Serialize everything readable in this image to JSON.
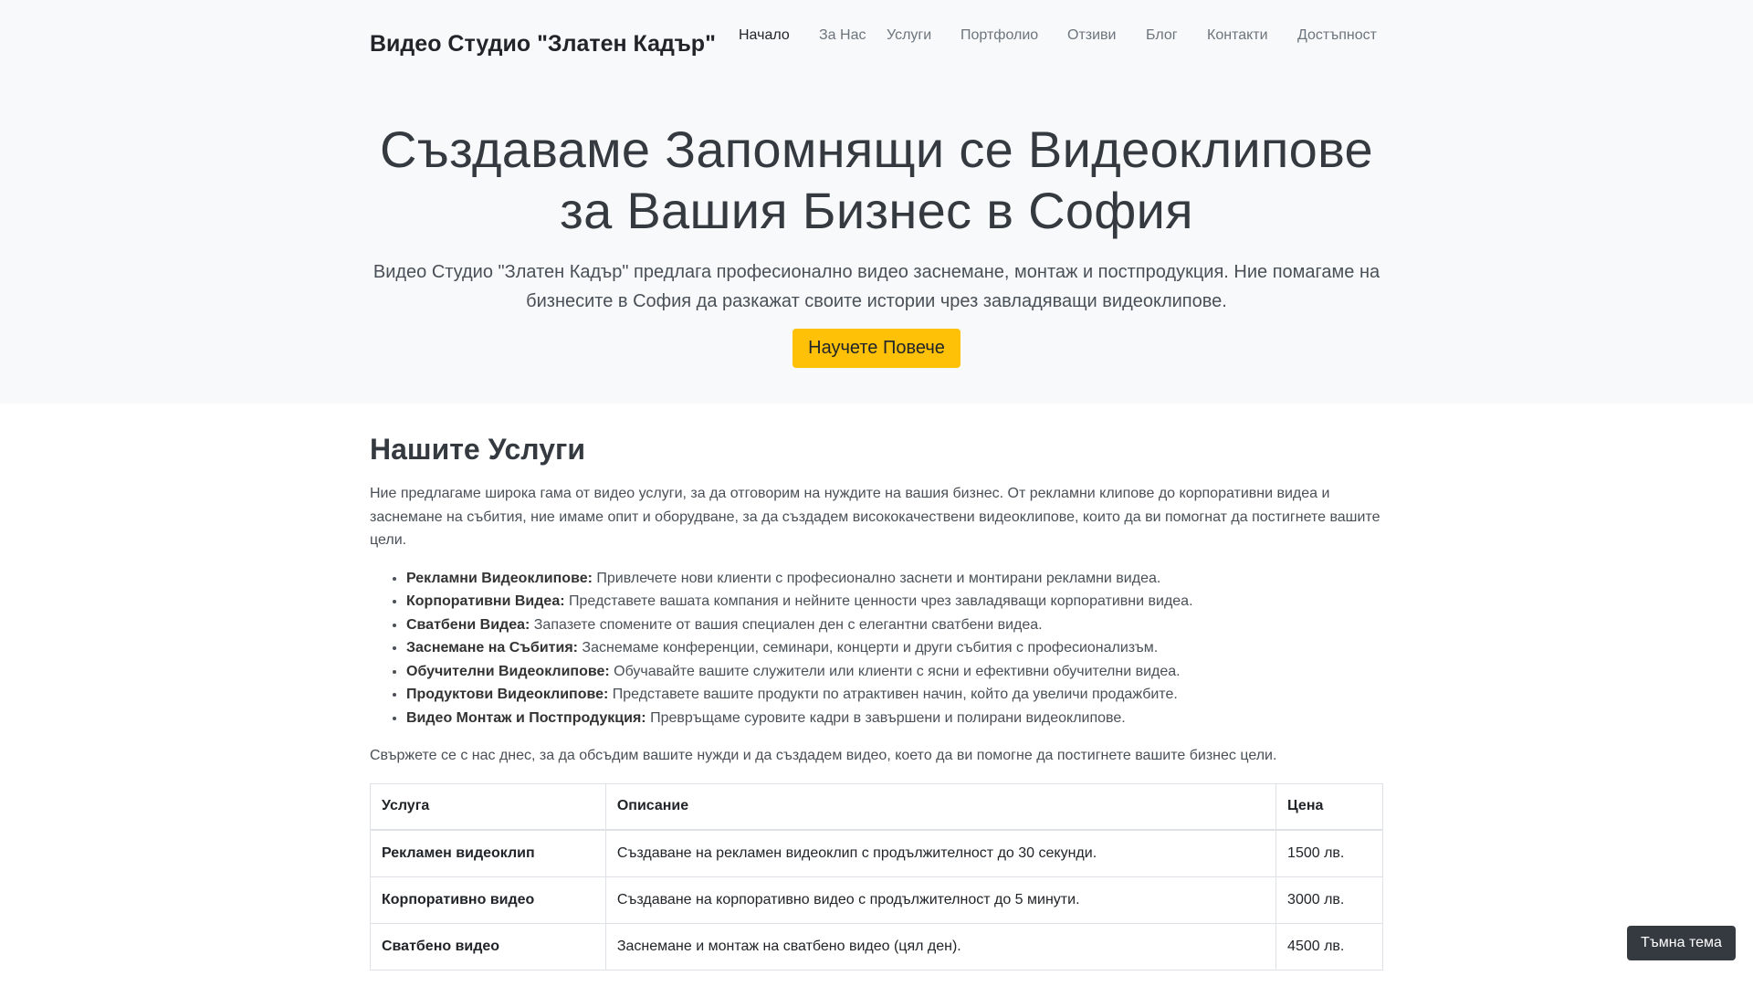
{
  "header": {
    "brand": "Видео Студио \"Златен Кадър\"",
    "nav": [
      "Начало",
      "За Нас",
      "Услуги",
      "Портфолио",
      "Отзиви",
      "Блог",
      "Контакти",
      "Достъпност"
    ],
    "active_nav": "Начало"
  },
  "hero": {
    "title": "Създаваме Запомнящи се Видеоклипове за Вашия Бизнес в София",
    "lead": "Видео Студио \"Златен Кадър\" предлага професионално видео заснемане, монтаж и постпродукция. Ние помагаме на бизнесите в София да разкажат своите истории чрез завладяващи видеоклипове.",
    "cta_label": "Научете Повече"
  },
  "services": {
    "heading": "Нашите Услуги",
    "intro": "Ние предлагаме широка гама от видео услуги, за да отговорим на нуждите на вашия бизнес. От рекламни клипове до корпоративни видеа и заснемане на събития, ние имаме опит и оборудване, за да създадем висококачествени видеоклипове, които да ви помогнат да постигнете вашите цели.",
    "items": [
      {
        "title": "Рекламни Видеоклипове:",
        "text": " Привлечете нови клиенти с професионално заснети и монтирани рекламни видеа."
      },
      {
        "title": "Корпоративни Видеа:",
        "text": " Представете вашата компания и нейните ценности чрез завладяващи корпоративни видеа."
      },
      {
        "title": "Сватбени Видеа:",
        "text": " Запазете спомените от вашия специален ден с елегантни сватбени видеа."
      },
      {
        "title": "Заснемане на Събития:",
        "text": " Заснемаме конференции, семинари, концерти и други събития с професионализъм."
      },
      {
        "title": "Обучителни Видеоклипове:",
        "text": " Обучавайте вашите служители или клиенти с ясни и ефективни обучителни видеа."
      },
      {
        "title": "Продуктови Видеоклипове:",
        "text": " Представете вашите продукти по атрактивен начин, който да увеличи продажбите."
      },
      {
        "title": "Видео Монтаж и Постпродукция:",
        "text": " Превръщаме суровите кадри в завършени и полирани видеоклипове."
      }
    ],
    "outro": "Свържете се с нас днес, за да обсъдим вашите нужди и да създадем видео, което да ви помогне да постигнете вашите бизнес цели.",
    "table": {
      "headers": [
        "Услуга",
        "Описание",
        "Цена"
      ],
      "rows": [
        [
          "Рекламен видеоклип",
          "Създаване на рекламен видеоклип с продължителност до 30 секунди.",
          "1500 лв."
        ],
        [
          "Корпоративно видео",
          "Създаване на корпоративно видео с продължителност до 5 минути.",
          "3000 лв."
        ],
        [
          "Сватбено видео",
          "Заснемане и монтаж на сватбено видео (цял ден).",
          "4500 лв."
        ]
      ]
    }
  },
  "scroll_progress": 0.12,
  "theme_toggle_label": "Тъмна тема",
  "colors": {
    "accent": "#ffc107",
    "progress": "#f5b400",
    "hero_bg": "#f8f9fa",
    "toggle_bg": "#343a40"
  }
}
